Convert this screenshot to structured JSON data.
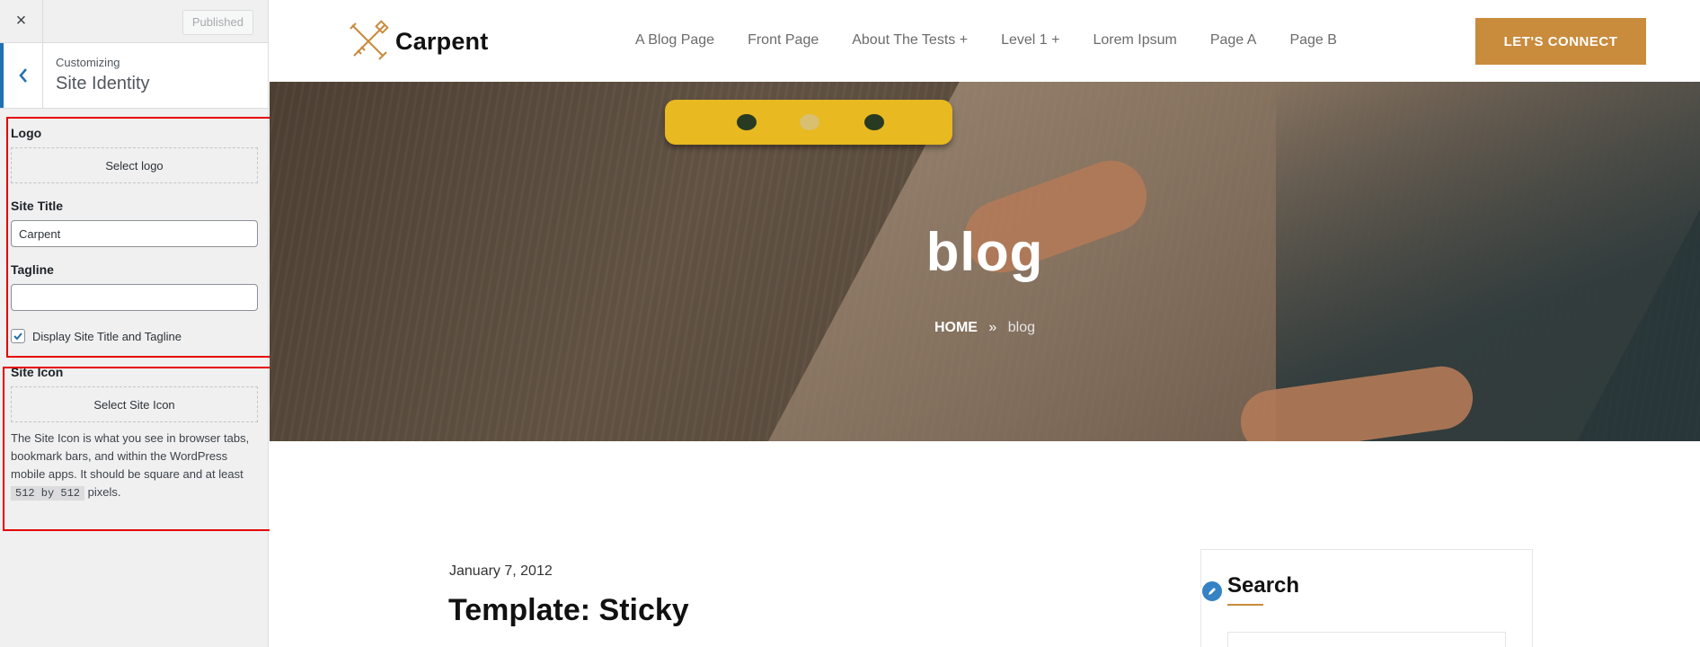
{
  "customizer": {
    "close_icon": "×",
    "published_label": "Published",
    "crumb_small": "Customizing",
    "crumb_title": "Site Identity",
    "logo": {
      "label": "Logo",
      "button": "Select logo"
    },
    "site_title": {
      "label": "Site Title",
      "value": "Carpent"
    },
    "tagline": {
      "label": "Tagline",
      "value": ""
    },
    "display_checkbox": {
      "label": "Display Site Title and Tagline",
      "checked": true
    },
    "site_icon": {
      "label": "Site Icon",
      "button": "Select Site Icon",
      "desc_1": "The Site Icon is what you see in browser tabs, bookmark bars, and within the WordPress mobile apps. It should be square and at least",
      "code": "512 by 512",
      "desc_2": "pixels."
    },
    "highlight_color": "#e50000"
  },
  "site": {
    "logo_text": "Carpent",
    "nav": [
      "A Blog Page",
      "Front Page",
      "About The Tests +",
      "Level 1 +",
      "Lorem Ipsum",
      "Page A",
      "Page B"
    ],
    "cta": "LET'S CONNECT",
    "accent": "#c98b3c",
    "hero": {
      "title": "blog",
      "crumb_home": "HOME",
      "crumb_sep": "»",
      "crumb_current": "blog"
    },
    "post": {
      "date": "January 7, 2012",
      "title": "Template: Sticky"
    },
    "widget": {
      "title": "Search"
    }
  }
}
